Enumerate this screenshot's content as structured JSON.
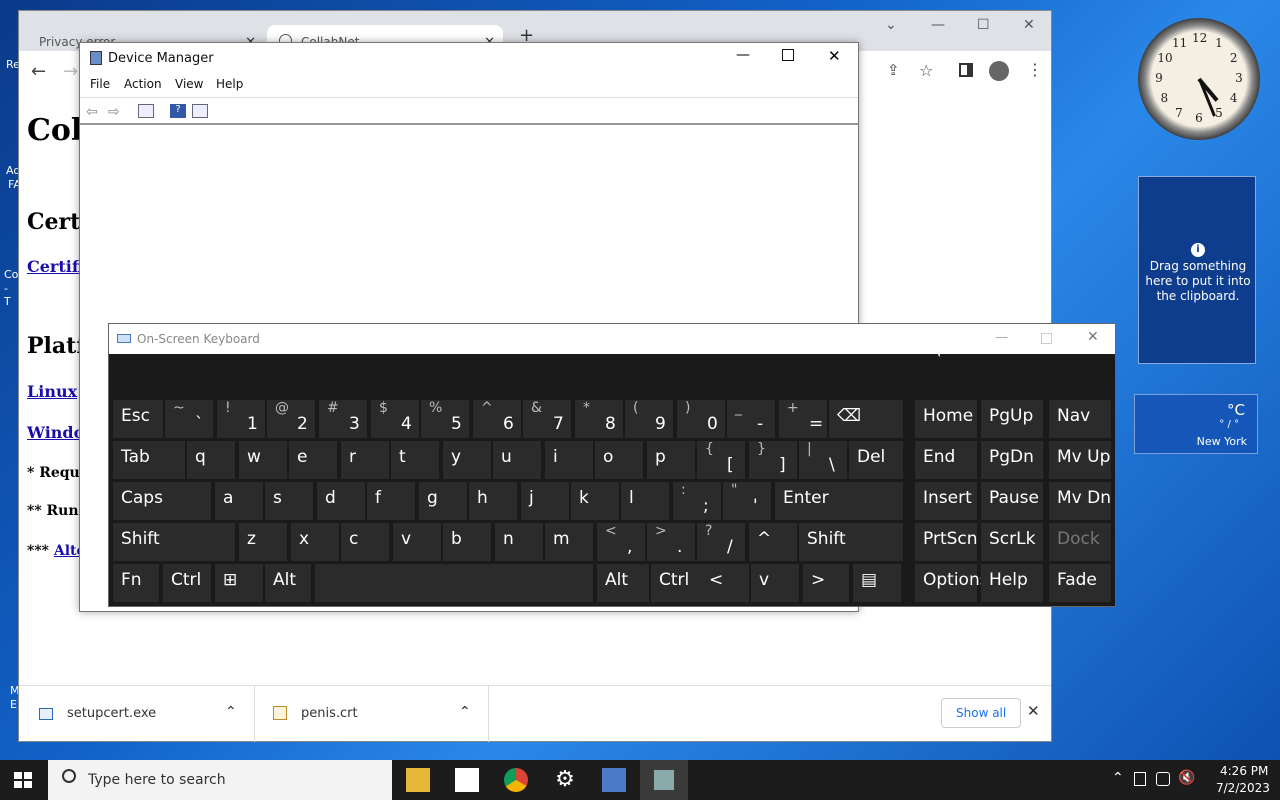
{
  "desktop": {
    "left_fragments": [
      "Re",
      "Ad",
      "FA",
      "Co",
      "- T",
      "M",
      "E"
    ]
  },
  "chrome": {
    "tabs": [
      {
        "label": "Privacy error"
      },
      {
        "label": "CollabNet"
      }
    ],
    "new_tab": "+",
    "page": {
      "heading": "Coll",
      "section1": "Certi",
      "link1": "Certifi",
      "section2": "Platfo",
      "link2": "Linux",
      "link3": "Windo",
      "note1": "* Requi",
      "note2": "** Run",
      "note3_prefix": "***",
      "note3_link": "Alte"
    },
    "downloads": [
      {
        "name": "setupcert.exe"
      },
      {
        "name": "penis.crt"
      }
    ],
    "show_all": "Show all"
  },
  "device_manager": {
    "title": "Device Manager",
    "menu": [
      "File",
      "Action",
      "View",
      "Help"
    ]
  },
  "osk": {
    "title": "On-Screen Keyboard",
    "rows": [
      [
        {
          "label": "Esc"
        },
        {
          "top": "~",
          "bot": "`"
        },
        {
          "top": "!",
          "bot": "1"
        },
        {
          "top": "@",
          "bot": "2"
        },
        {
          "top": "#",
          "bot": "3"
        },
        {
          "top": "$",
          "bot": "4"
        },
        {
          "top": "%",
          "bot": "5"
        },
        {
          "top": "^",
          "bot": "6"
        },
        {
          "top": "&",
          "bot": "7"
        },
        {
          "top": "*",
          "bot": "8"
        },
        {
          "top": "(",
          "bot": "9"
        },
        {
          "top": ")",
          "bot": "0"
        },
        {
          "top": "_",
          "bot": "-"
        },
        {
          "top": "+",
          "bot": "="
        },
        {
          "label": "⌫"
        },
        {
          "label": "Home"
        },
        {
          "label": "PgUp"
        },
        {
          "label": "Nav"
        }
      ],
      [
        {
          "label": "Tab"
        },
        {
          "label": "q"
        },
        {
          "label": "w"
        },
        {
          "label": "e"
        },
        {
          "label": "r"
        },
        {
          "label": "t"
        },
        {
          "label": "y"
        },
        {
          "label": "u"
        },
        {
          "label": "i"
        },
        {
          "label": "o"
        },
        {
          "label": "p"
        },
        {
          "top": "{",
          "bot": "["
        },
        {
          "top": "}",
          "bot": "]"
        },
        {
          "top": "|",
          "bot": "\\"
        },
        {
          "label": "Del"
        },
        {
          "label": "End"
        },
        {
          "label": "PgDn"
        },
        {
          "label": "Mv Up"
        }
      ],
      [
        {
          "label": "Caps"
        },
        {
          "label": "a"
        },
        {
          "label": "s"
        },
        {
          "label": "d"
        },
        {
          "label": "f"
        },
        {
          "label": "g"
        },
        {
          "label": "h"
        },
        {
          "label": "j"
        },
        {
          "label": "k"
        },
        {
          "label": "l"
        },
        {
          "top": ":",
          "bot": ";"
        },
        {
          "top": "\"",
          "bot": "'"
        },
        {
          "label": "Enter"
        },
        {
          "label": "Insert"
        },
        {
          "label": "Pause"
        },
        {
          "label": "Mv Dn"
        }
      ],
      [
        {
          "label": "Shift"
        },
        {
          "label": "z"
        },
        {
          "label": "x"
        },
        {
          "label": "c"
        },
        {
          "label": "v"
        },
        {
          "label": "b"
        },
        {
          "label": "n"
        },
        {
          "label": "m"
        },
        {
          "top": "<",
          "bot": ","
        },
        {
          "top": ">",
          "bot": "."
        },
        {
          "top": "?",
          "bot": "/"
        },
        {
          "label": "^"
        },
        {
          "label": "Shift"
        },
        {
          "label": "PrtScn"
        },
        {
          "label": "ScrLk"
        },
        {
          "label": "Dock",
          "dim": true
        }
      ],
      [
        {
          "label": "Fn"
        },
        {
          "label": "Ctrl"
        },
        {
          "label": "⊞"
        },
        {
          "label": "Alt"
        },
        {
          "label": ""
        },
        {
          "label": "Alt"
        },
        {
          "label": "Ctrl"
        },
        {
          "label": "<"
        },
        {
          "label": "v"
        },
        {
          "label": ">"
        },
        {
          "label": "▤"
        },
        {
          "label": "Options"
        },
        {
          "label": "Help"
        },
        {
          "label": "Fade"
        }
      ]
    ]
  },
  "gadgets": {
    "clipboard_text": "Drag something here to put it into the clipboard.",
    "weather_temp": "°C",
    "weather_range": "° / °",
    "weather_city": "New York",
    "clock_numbers": [
      "12",
      "1",
      "2",
      "3",
      "4",
      "5",
      "6",
      "7",
      "8",
      "9",
      "10",
      "11"
    ]
  },
  "taskbar": {
    "search_placeholder": "Type here to search",
    "time": "4:26 PM",
    "date": "7/2/2023"
  }
}
